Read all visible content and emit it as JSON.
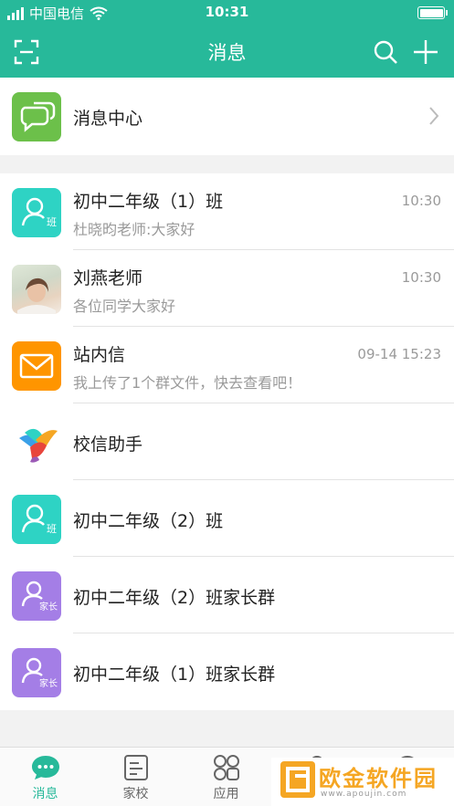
{
  "status_bar": {
    "carrier": "中国电信",
    "time": "10:31"
  },
  "nav": {
    "title": "消息"
  },
  "message_center": {
    "title": "消息中心"
  },
  "messages": [
    {
      "title": "初中二年级（1）班",
      "subtitle": "杜晓昀老师:大家好",
      "time": "10:30",
      "avatar_text": "班",
      "avatar_color": "#2ed3c4"
    },
    {
      "title": "刘燕老师",
      "subtitle": "各位同学大家好",
      "time": "10:30"
    },
    {
      "title": "站内信",
      "subtitle": "我上传了1个群文件，快去查看吧！",
      "time": "09-14 15:23",
      "avatar_color": "#ff9500"
    },
    {
      "title": "校信助手"
    },
    {
      "title": "初中二年级（2）班",
      "avatar_text": "班",
      "avatar_color": "#2ed3c4"
    },
    {
      "title": "初中二年级（2）班家长群",
      "avatar_text": "家长",
      "avatar_color": "#a47ee6"
    },
    {
      "title": "初中二年级（1）班家长群",
      "avatar_text": "家长",
      "avatar_color": "#a47ee6"
    }
  ],
  "tabs": [
    {
      "label": "消息",
      "icon": "chat-bubble-icon"
    },
    {
      "label": "家校",
      "icon": "document-icon"
    },
    {
      "label": "应用",
      "icon": "apps-icon"
    },
    {
      "label": "",
      "icon": "contacts-icon"
    },
    {
      "label": "",
      "icon": "profile-icon"
    }
  ],
  "watermark": {
    "text": "欧金软件园",
    "sub": "www.apoujin.com"
  },
  "colors": {
    "brand": "#27b99a",
    "message_center_icon": "#6cc04a",
    "divider": "#e3e3e3"
  }
}
